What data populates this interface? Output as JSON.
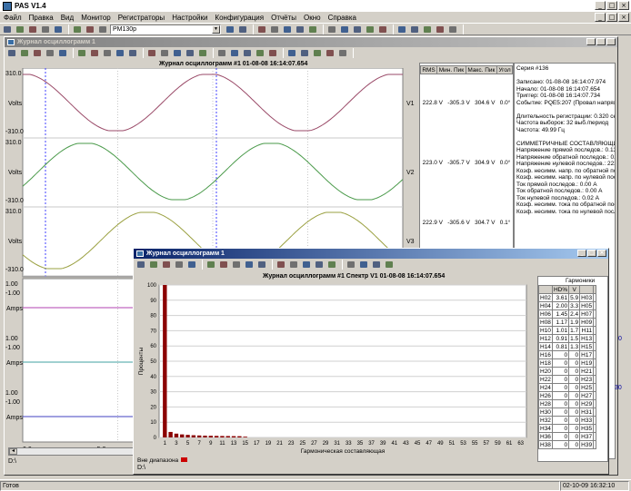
{
  "app": {
    "title": "PAS V1.4"
  },
  "menu": [
    "Файл",
    "Правка",
    "Вид",
    "Монитор",
    "Регистраторы",
    "Настройки",
    "Конфигурация",
    "Отчёты",
    "Окно",
    "Справка"
  ],
  "toolbar": {
    "device": "PM130p"
  },
  "main_window": {
    "title": "Журнал осциллограмм 1",
    "chart_title": "Журнал осциллограмм #1   01-08-08   16:14:07.654",
    "path": "D:\\",
    "channels": [
      {
        "name": "V1",
        "ymax": "310.0",
        "ymin": "-310.0",
        "unit": "Volts",
        "rms": "222.8 V",
        "min": "-305.3 V",
        "max": "304.6 V",
        "angle": "0.0°",
        "color": "#9a4a68",
        "phase": 0
      },
      {
        "name": "V2",
        "ymax": "310.0",
        "ymin": "-310.0",
        "unit": "Volts",
        "rms": "223.0 V",
        "min": "-305.7 V",
        "max": "304.9 V",
        "angle": "0.0°",
        "color": "#4a9a4a",
        "phase": 1
      },
      {
        "name": "V3",
        "ymax": "310.0",
        "ymin": "-310.0",
        "unit": "Volts",
        "rms": "222.9 V",
        "min": "-305.6 V",
        "max": "304.7 V",
        "angle": "0.1°",
        "color": "#9aa040",
        "phase": 2
      }
    ],
    "currents": [
      {
        "unit": "Amps",
        "ymax": "1.00",
        "ymin": "-1.00",
        "color": "#b040b0"
      },
      {
        "unit": "Amps",
        "ymax": "1.00",
        "ymin": "-1.00",
        "color": "#40a0a0"
      },
      {
        "unit": "Amps",
        "ymax": "1.00",
        "ymin": "-1.00",
        "color": "#4040c0"
      }
    ],
    "xticks": [
      "0.0",
      "5.0",
      "10.0"
    ],
    "table_headers": [
      "RMS",
      "Мин. Пик",
      "Макс. Пик",
      "Угол"
    ],
    "info_lines": [
      "Серия #136",
      "",
      "Записано:  01-08-08  16:14:07.974",
      "Начало:    01-08-08  16:14:07.654",
      "Триггер:   01-08-08  16:14:07.734",
      "Событие: PQE5:207 (Провал напряжения",
      "",
      "Длительность регистрации: 0.320 сек",
      "Частота выборок: 32 выб./период",
      "Частота: 49.99 Гц",
      "",
      "СИММЕТРИЧНЫЕ СОСТАВЛЯЮЩИЕ",
      "Напряжение прямой последов.: 0.13 V",
      "Напряжение обратной последов.: 0.19",
      "Напряжение нулевой последов.: 222.",
      "Коэф. несимм. напр. по обратной послед",
      "Коэф. несимм. напр. по нулевой послед",
      "Ток прямой последов.: 0.00 A",
      "Ток обратной последов.: 0.00 A",
      "Ток нулевой последов.: 0.02 A",
      "Коэф. несимм. тока по обратной послед",
      "Коэф. несимм. тока по нулевой послед"
    ],
    "side_numbers": [
      "0",
      "30"
    ]
  },
  "spectrum_window": {
    "title": "Журнал осциллограмм 1",
    "chart_title": "Журнал осциллограмм #1   Спектр V1   01-08-08   16:14:07.654",
    "ylabel": "Проценты",
    "xlabel": "Гармоническая составляющая",
    "legend": "Вне диапазона",
    "path": "D:\\",
    "table_title": "Гармоники",
    "table_headers": [
      "",
      "HD%",
      "V",
      "",
      ""
    ],
    "rows": [
      [
        "H02",
        "3.61",
        "5.9",
        "H03"
      ],
      [
        "H04",
        "2.00",
        "3.3",
        "H05"
      ],
      [
        "H06",
        "1.45",
        "2.4",
        "H07"
      ],
      [
        "H08",
        "1.17",
        "1.9",
        "H09"
      ],
      [
        "H10",
        "1.01",
        "1.7",
        "H11"
      ],
      [
        "H12",
        "0.91",
        "1.5",
        "H13"
      ],
      [
        "H14",
        "0.81",
        "1.3",
        "H15"
      ],
      [
        "H16",
        "0",
        "0",
        "H17"
      ],
      [
        "H18",
        "0",
        "0",
        "H19"
      ],
      [
        "H20",
        "0",
        "0",
        "H21"
      ],
      [
        "H22",
        "0",
        "0",
        "H23"
      ],
      [
        "H24",
        "0",
        "0",
        "H25"
      ],
      [
        "H26",
        "0",
        "0",
        "H27"
      ],
      [
        "H28",
        "0",
        "0",
        "H29"
      ],
      [
        "H30",
        "0",
        "0",
        "H31"
      ],
      [
        "H32",
        "0",
        "0",
        "H33"
      ],
      [
        "H34",
        "0",
        "0",
        "H35"
      ],
      [
        "H36",
        "0",
        "0",
        "H37"
      ],
      [
        "H38",
        "0",
        "0",
        "H39"
      ]
    ]
  },
  "chart_data": {
    "type": "bar",
    "title": "Журнал осциллограмм #1   Спектр V1   01-08-08   16:14:07.654",
    "xlabel": "Гармоническая составляющая",
    "ylabel": "Проценты",
    "ylim": [
      0,
      100
    ],
    "yticks": [
      "0",
      "10",
      "20",
      "30",
      "40",
      "50",
      "60",
      "70",
      "80",
      "90",
      "100"
    ],
    "categories": [
      "1",
      "2",
      "3",
      "4",
      "5",
      "6",
      "7",
      "8",
      "9",
      "10",
      "11",
      "12",
      "13",
      "14",
      "15"
    ],
    "values": [
      100,
      3.61,
      2.5,
      2.0,
      1.7,
      1.45,
      1.3,
      1.17,
      1.1,
      1.01,
      0.95,
      0.91,
      0.85,
      0.81,
      0.5
    ],
    "xticks": [
      "1",
      "3",
      "5",
      "7",
      "9",
      "11",
      "13",
      "15",
      "17",
      "19",
      "21",
      "23",
      "25",
      "27",
      "29",
      "31",
      "33",
      "35",
      "37",
      "39",
      "41",
      "43",
      "45",
      "47",
      "49",
      "51",
      "53",
      "55",
      "57",
      "59",
      "61",
      "63"
    ]
  },
  "status": {
    "left": "Готов",
    "right": "02-10-09 16:32:10"
  }
}
